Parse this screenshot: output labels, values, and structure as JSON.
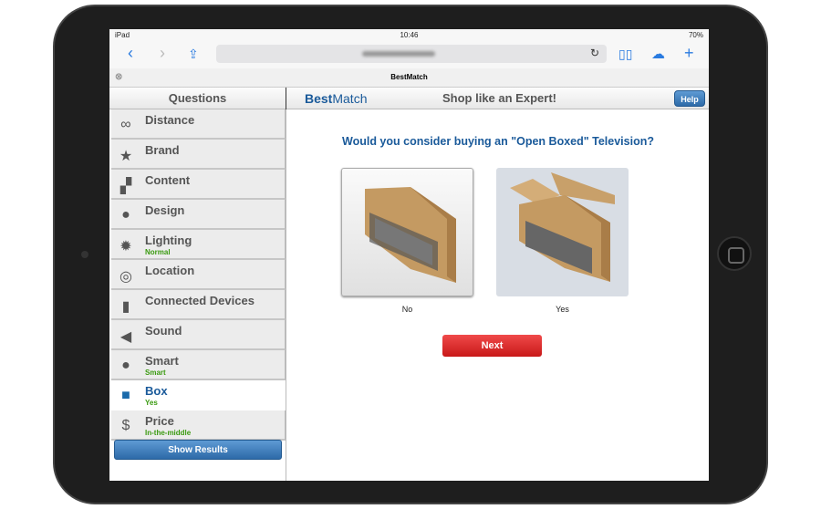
{
  "status": {
    "device": "iPad",
    "time": "10:46",
    "battery": "70%"
  },
  "browser": {
    "tab_title": "BestMatch"
  },
  "header": {
    "questions_title": "Questions",
    "logo_bold": "Best",
    "logo_light": "Match",
    "tagline": "Shop like an Expert!",
    "help": "Help"
  },
  "sidebar": {
    "items": [
      {
        "label": "Distance",
        "icon": "binoculars-icon",
        "sub": ""
      },
      {
        "label": "Brand",
        "icon": "star-icon",
        "sub": ""
      },
      {
        "label": "Content",
        "icon": "clapperboard-icon",
        "sub": ""
      },
      {
        "label": "Design",
        "icon": "palette-icon",
        "sub": ""
      },
      {
        "label": "Lighting",
        "icon": "sun-icon",
        "sub": "Normal"
      },
      {
        "label": "Location",
        "icon": "target-icon",
        "sub": ""
      },
      {
        "label": "Connected Devices",
        "icon": "usb-icon",
        "sub": ""
      },
      {
        "label": "Sound",
        "icon": "speaker-icon",
        "sub": ""
      },
      {
        "label": "Smart",
        "icon": "lightbulb-icon",
        "sub": "Smart"
      },
      {
        "label": "Box",
        "icon": "box-icon",
        "sub": "Yes",
        "active": true
      },
      {
        "label": "Price",
        "icon": "dollar-icon",
        "sub": "In-the-middle"
      }
    ],
    "show_results": "Show Results"
  },
  "main": {
    "question": "Would you consider buying an \"Open Boxed\" Television?",
    "options": [
      "No",
      "Yes"
    ],
    "next": "Next"
  },
  "colors": {
    "accent": "#1a5a9a",
    "selected_green": "#3a9a10",
    "next_red": "#d82020"
  }
}
